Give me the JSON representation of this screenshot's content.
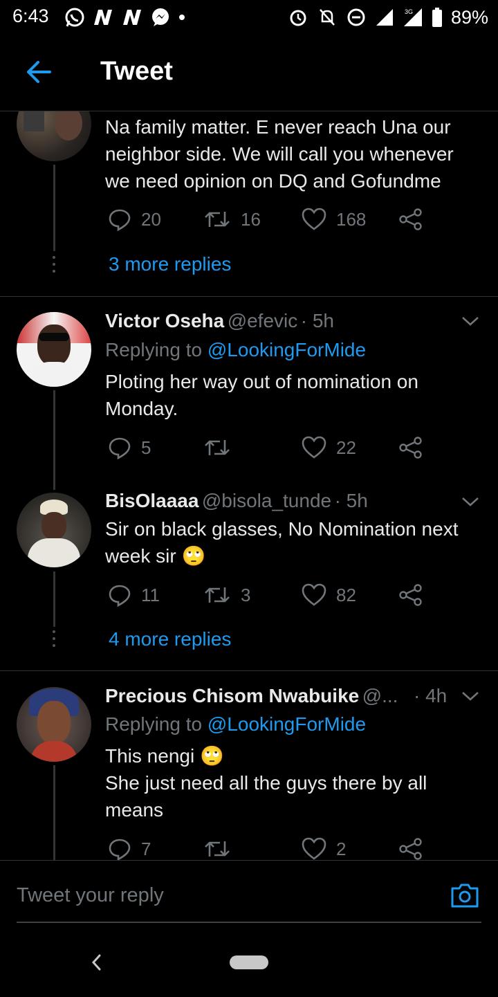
{
  "status_bar": {
    "time": "6:43",
    "battery": "89%",
    "network": "3G"
  },
  "header": {
    "title": "Tweet"
  },
  "tweets": [
    {
      "text": "Na family matter. E never reach Una  our neighbor side. We will call you whenever we need opinion on DQ and Gofundme",
      "reply_count": "20",
      "retweet_count": "16",
      "like_count": "168",
      "more_replies": "3 more replies"
    },
    {
      "name": "Victor Oseha",
      "handle": "@efevic",
      "time": "· 5h",
      "replying_prefix": "Replying to ",
      "replying_to": "@LookingForMide",
      "text": "Ploting her way out of nomination on Monday.",
      "reply_count": "5",
      "retweet_count": "",
      "like_count": "22"
    },
    {
      "name": "BisOlaaaa",
      "handle": "@bisola_tunde",
      "time": "· 5h",
      "text": "Sir on black glasses, No Nomination next week sir",
      "emoji": "🙄",
      "reply_count": "11",
      "retweet_count": "3",
      "like_count": "82",
      "more_replies": "4 more replies"
    },
    {
      "name": "Precious Chisom Nwabuike",
      "handle": "@...",
      "time": "· 4h",
      "replying_prefix": "Replying to ",
      "replying_to": "@LookingForMide",
      "text_line1": "This nengi",
      "emoji": "🙄",
      "text_rest": "She just need all the guys there by all means",
      "reply_count": "7",
      "retweet_count": "",
      "like_count": "2"
    }
  ],
  "reply_box": {
    "placeholder": "Tweet your reply"
  },
  "colors": {
    "accent": "#1d9bf0",
    "muted": "#71767b",
    "background": "#000000"
  }
}
